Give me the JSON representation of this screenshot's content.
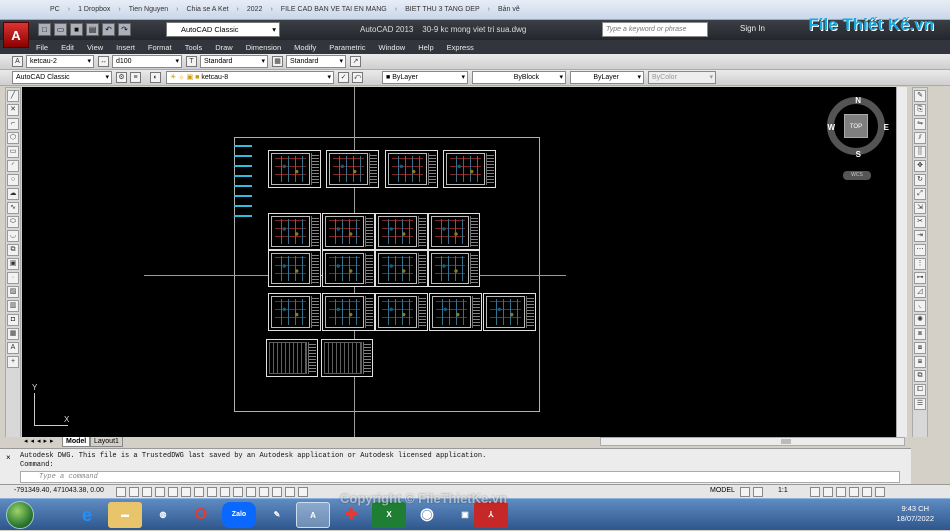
{
  "explorer": {
    "crumbs": [
      "PC",
      "1 Dropbox",
      "Tien Nguyen",
      "Chia se A Ket",
      "2022",
      "FILE CAD BAN VE TAI EN MANG",
      "BIET THU 3 TANG DEP",
      "Bản vẽ"
    ]
  },
  "brand": {
    "logo_text": "File Thiết Kế.vn"
  },
  "titlebar": {
    "workspace": "AutoCAD Classic",
    "app_title": "AutoCAD 2013",
    "file_name": "30-9 kc mong viet tri sua.dwg",
    "search_placeholder": "Type a keyword or phrase",
    "sign_in": "Sign In"
  },
  "menu": [
    "File",
    "Edit",
    "View",
    "Insert",
    "Format",
    "Tools",
    "Draw",
    "Dimension",
    "Modify",
    "Parametric",
    "Window",
    "Help",
    "Express"
  ],
  "toolbar1": {
    "layer": "ketcau-2",
    "dimstyle": "d100",
    "textstyle": "Standard",
    "tablestyle": "Standard"
  },
  "toolbar2": {
    "workspace": "AutoCAD Classic",
    "current_layer": "ketcau-8",
    "color": "ByLayer",
    "linetype": "ByBlock",
    "lineweight": "ByLayer",
    "plotstyle": "ByColor"
  },
  "viewcube": {
    "north": "N",
    "south": "S",
    "east": "E",
    "west": "W",
    "face": "TOP",
    "wcs": "WCS"
  },
  "ucs": {
    "x": "X",
    "y": "Y"
  },
  "tabs": [
    "Model",
    "Layout1"
  ],
  "command": {
    "history": "Autodesk DWG.  This file is a TrustedDWG last saved by an Autodesk application or Autodesk licensed application.",
    "prompt_label": "Command:",
    "placeholder": "Type a command"
  },
  "status": {
    "coordinates": "-791349.40, 471043.38, 0.00",
    "model": "MODEL",
    "scale": "1:1"
  },
  "taskbar": {
    "time": "9:43 CH",
    "date": "18/07/2022"
  },
  "watermark": "Copyright © FileThietKe.vn",
  "colors": {
    "canvas": "#000000",
    "title": "#23262b",
    "brand": "#16a9e0"
  }
}
